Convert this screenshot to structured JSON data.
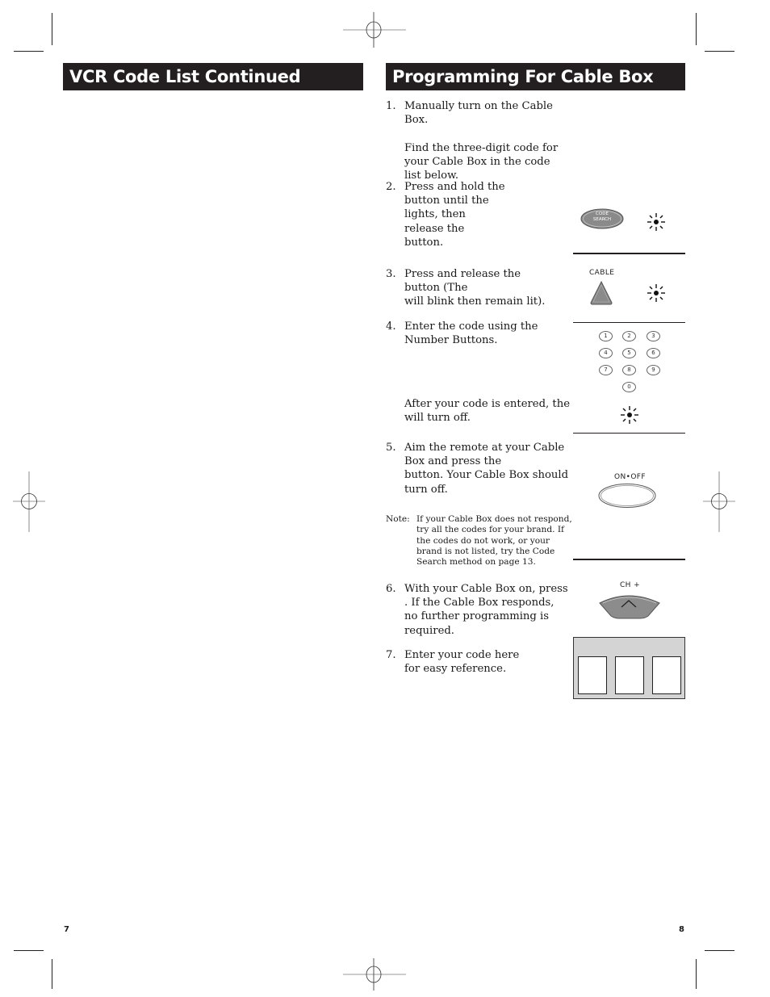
{
  "left_page": {
    "title": "VCR Code List Continued",
    "page_number": "7"
  },
  "right_page": {
    "title": "Programming For Cable Box",
    "page_number": "8",
    "steps": [
      {
        "num": "1.",
        "text": "Manually turn on the Cable Box.\n\nFind the three-digit code for\nyour Cable Box in the code\nlist below."
      },
      {
        "num": "2.",
        "text": "Press and hold the\n                  button until the\n                              lights, then\nrelease the\nbutton."
      },
      {
        "num": "3.",
        "text": "Press and release the\nbutton (The\nwill blink then remain lit)."
      },
      {
        "num": "4.",
        "text": "Enter the code using the\nNumber Buttons."
      },
      {
        "num": "",
        "text": "After your code is entered, the\n                              will turn off."
      },
      {
        "num": "5.",
        "text": "Aim the remote at your Cable\nBox and press the\nbutton. Your Cable Box should\nturn off."
      },
      {
        "num": "6.",
        "text": "With your Cable Box on, press\n         . If the Cable Box responds,\nno further programming is\nrequired."
      },
      {
        "num": "7.",
        "text": "Enter your code here\nfor easy reference."
      }
    ],
    "note": {
      "label": "Note:",
      "text": "If your Cable Box does not respond, try all the codes for your brand. If the codes do not work, or your brand is not listed, try the Code Search method on page 13."
    },
    "illustrations": {
      "code_search_button": {
        "line1": "CODE",
        "line2": "SEARCH"
      },
      "cable_button_label": "CABLE",
      "keypad_keys": [
        "1",
        "2",
        "3",
        "4",
        "5",
        "6",
        "7",
        "8",
        "9",
        "0"
      ],
      "on_off_label": "ON•OFF",
      "ch_plus_label": "CH +"
    }
  }
}
